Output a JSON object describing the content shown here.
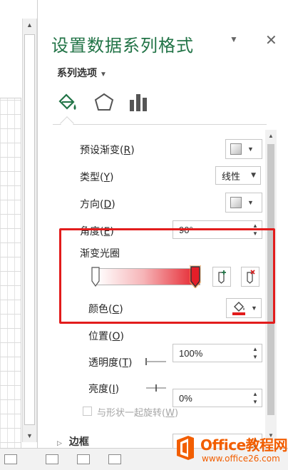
{
  "pane": {
    "title": "设置数据系列格式",
    "section_label": "系列选项",
    "tabs": [
      "fill-line-icon",
      "effects-pentagon-icon",
      "series-options-bar-icon"
    ]
  },
  "fill": {
    "preset_gradient": {
      "label": "预设渐变(",
      "key": "R",
      "suffix": ")"
    },
    "type": {
      "label": "类型(",
      "key": "Y",
      "suffix": ")",
      "value": "线性"
    },
    "direction": {
      "label": "方向(",
      "key": "D",
      "suffix": ")"
    },
    "angle": {
      "label": "角度(",
      "key": "E",
      "suffix": ")",
      "value": "90°"
    },
    "gradient_stops": {
      "label": "渐变光圈",
      "stop_count": 2
    },
    "color": {
      "label": "颜色(",
      "key": "C",
      "suffix": ")",
      "accent": "#e21c1c"
    },
    "position": {
      "label": "位置(",
      "key": "O",
      "suffix": ")",
      "value": "100%"
    },
    "transparency": {
      "label": "透明度(",
      "key": "T",
      "suffix": ")",
      "value": "0%"
    },
    "brightness": {
      "label": "亮度(",
      "key": "I",
      "suffix": ")",
      "value": "0%"
    },
    "rotate_with_shape": {
      "label": "与形状一起旋转(",
      "key": "W",
      "suffix": ")",
      "checked": false
    }
  },
  "border": {
    "label": "边框"
  },
  "watermark": {
    "brand": "Office教程网",
    "url": "www.office26.com"
  },
  "colors": {
    "title_green": "#217346",
    "highlight_red": "#e21c1c",
    "stop_red": "#e41e28",
    "brand_orange": "#f25e00"
  }
}
